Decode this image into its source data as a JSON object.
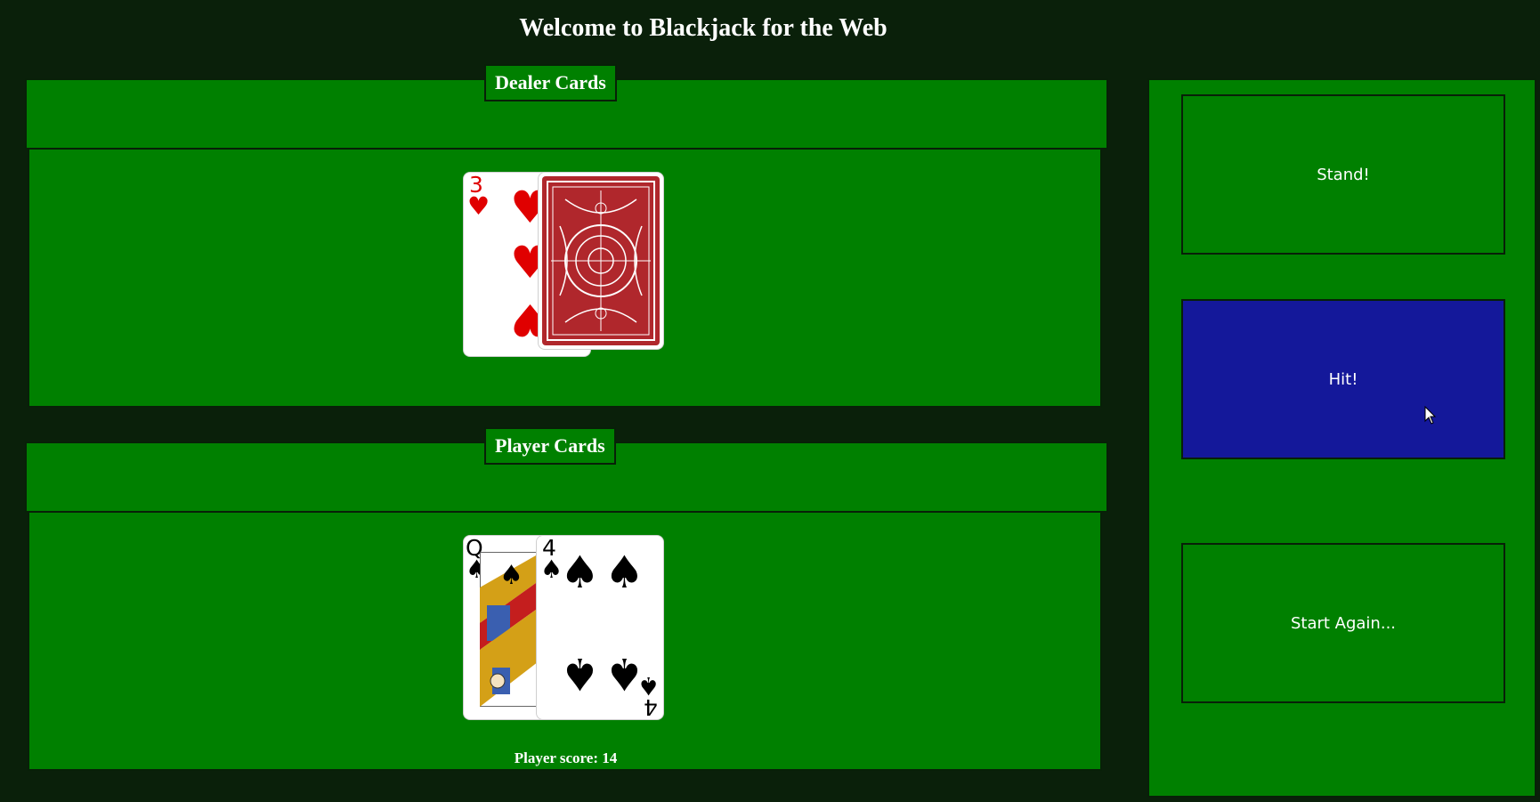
{
  "header": {
    "title": "Welcome to Blackjack for the Web"
  },
  "dealer": {
    "label": "Dealer Cards",
    "cards": [
      {
        "rank": "3",
        "suit": "♥",
        "color": "red",
        "face_up": true
      },
      {
        "face_up": false,
        "back_color": "#b0272c"
      }
    ]
  },
  "player": {
    "label": "Player Cards",
    "cards": [
      {
        "rank": "Q",
        "suit": "♠",
        "color": "black",
        "face_up": true
      },
      {
        "rank": "4",
        "suit": "♠",
        "color": "black",
        "face_up": true
      }
    ],
    "score_text": "Player score: 14"
  },
  "actions": {
    "stand_label": "Stand!",
    "hit_label": "Hit!",
    "start_again_label": "Start Again..."
  },
  "colors": {
    "table_felt": "#008000",
    "background": "#0a200a",
    "hit_hover": "#14189a",
    "card_back": "#b0272c"
  }
}
